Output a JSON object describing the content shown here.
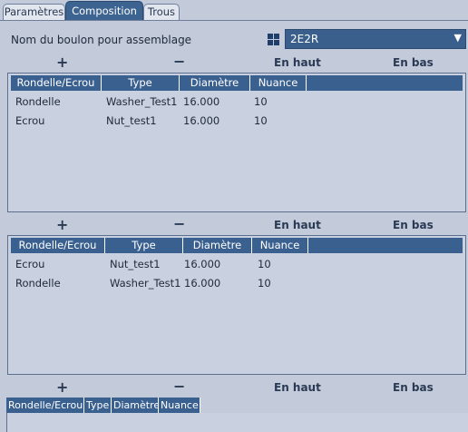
{
  "tabs": [
    {
      "label": "Paramètres",
      "active": false
    },
    {
      "label": "Composition",
      "active": true
    },
    {
      "label": "Trous",
      "active": false
    }
  ],
  "bolt_name_label": "Nom du boulon pour assemblage",
  "bolt_combo": {
    "value": "2E2R",
    "icon": "grid-icon",
    "arrow": "▼"
  },
  "toolbar": {
    "add": "+",
    "remove": "−",
    "up": "En haut",
    "down": "En bas"
  },
  "columns": [
    "Rondelle/Ecrou",
    "Type",
    "Diamètre",
    "Nuance"
  ],
  "table1": {
    "rows": [
      [
        "Rondelle",
        "Washer_Test1",
        "16.000",
        "10"
      ],
      [
        "Ecrou",
        "Nut_test1",
        "16.000",
        "10"
      ]
    ]
  },
  "table2": {
    "rows": [
      [
        "Ecrou",
        "Nut_test1",
        "16.000",
        "10"
      ],
      [
        "Rondelle",
        "Washer_Test1",
        "16.000",
        "10"
      ]
    ]
  },
  "colors": {
    "accent": "#3a6090",
    "background": "#c3cad9"
  }
}
